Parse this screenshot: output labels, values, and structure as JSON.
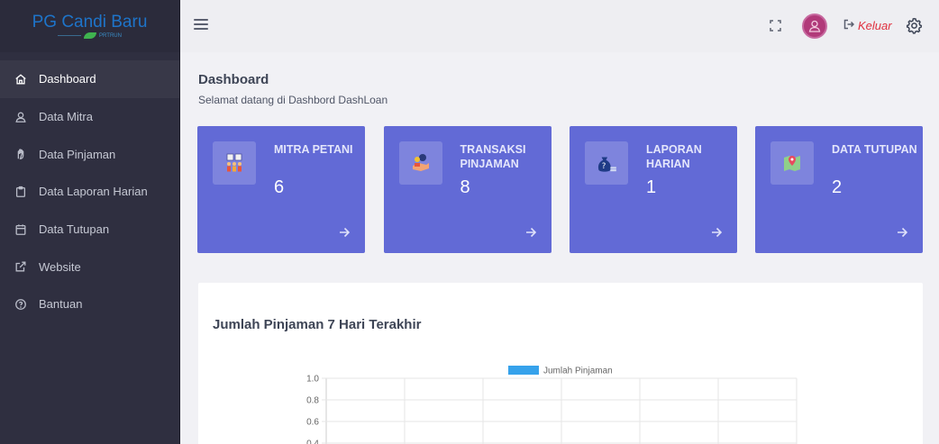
{
  "brand": {
    "title": "PG Candi Baru",
    "subtitle": "PRTRUN"
  },
  "sidebar": {
    "items": [
      {
        "label": "Dashboard",
        "icon": "home-icon",
        "active": true
      },
      {
        "label": "Data Mitra",
        "icon": "user-icon"
      },
      {
        "label": "Data Pinjaman",
        "icon": "hand-icon"
      },
      {
        "label": "Data Laporan Harian",
        "icon": "clipboard-icon"
      },
      {
        "label": "Data Tutupan",
        "icon": "calendar-icon"
      },
      {
        "label": "Website",
        "icon": "external-link-icon"
      },
      {
        "label": "Bantuan",
        "icon": "help-circle-icon"
      }
    ]
  },
  "topbar": {
    "logout_label": "Keluar"
  },
  "page": {
    "title": "Dashboard",
    "subtitle": "Selamat datang di Dashbord DashLoan"
  },
  "cards": [
    {
      "label": "MITRA PETANI",
      "value": "6",
      "icon": "farmers-icon"
    },
    {
      "label": "TRANSAKSI PINJAMAN",
      "value": "8",
      "icon": "money-hand-icon"
    },
    {
      "label": "LAPORAN HARIAN",
      "value": "1",
      "icon": "money-bag-icon"
    },
    {
      "label": "DATA TUTUPAN",
      "value": "2",
      "icon": "map-pin-icon"
    }
  ],
  "chart": {
    "title": "Jumlah Pinjaman 7 Hari Terakhir"
  },
  "chart_data": {
    "type": "bar",
    "series": [
      {
        "name": "Jumlah Pinjaman",
        "color": "#36a2eb"
      }
    ],
    "y_ticks_visible": [
      "1.0",
      "0.8",
      "0.6",
      "0.4"
    ],
    "grid": true,
    "legend": "top"
  },
  "colors": {
    "card_bg": "#626ad6",
    "sidebar_bg": "#2f2f40",
    "brand_blue": "#1e74c9",
    "logout_red": "#e0313f"
  }
}
